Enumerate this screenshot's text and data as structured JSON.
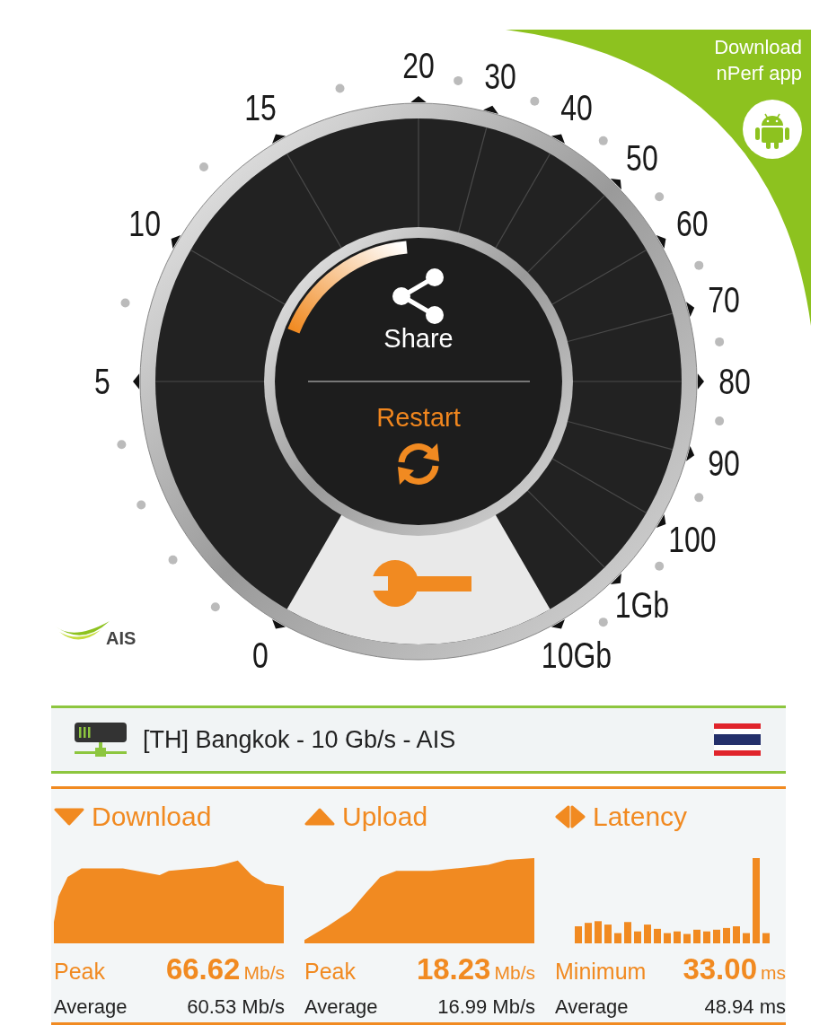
{
  "gauge": {
    "scale_labels": [
      "0",
      "5",
      "10",
      "15",
      "20",
      "30",
      "40",
      "50",
      "60",
      "70",
      "80",
      "90",
      "100",
      "1Gb",
      "10Gb"
    ],
    "share_label": "Share",
    "restart_label": "Restart"
  },
  "isp_logo": {
    "text": "AIS"
  },
  "banner": {
    "text": "Download nPerf app"
  },
  "server": {
    "name": "[TH] Bangkok - 10 Gb/s - AIS"
  },
  "results": [
    {
      "kind": "download",
      "title": "Download",
      "primary_label": "Peak",
      "primary_value": "66.62",
      "primary_unit": "Mb/s",
      "average_label": "Average",
      "average_value": "60.53 Mb/s"
    },
    {
      "kind": "upload",
      "title": "Upload",
      "primary_label": "Peak",
      "primary_value": "18.23",
      "primary_unit": "Mb/s",
      "average_label": "Average",
      "average_value": "16.99 Mb/s"
    },
    {
      "kind": "latency",
      "title": "Latency",
      "primary_label": "Minimum",
      "primary_value": "33.00",
      "primary_unit": "ms",
      "average_label": "Average",
      "average_value": "48.94 ms"
    }
  ]
}
